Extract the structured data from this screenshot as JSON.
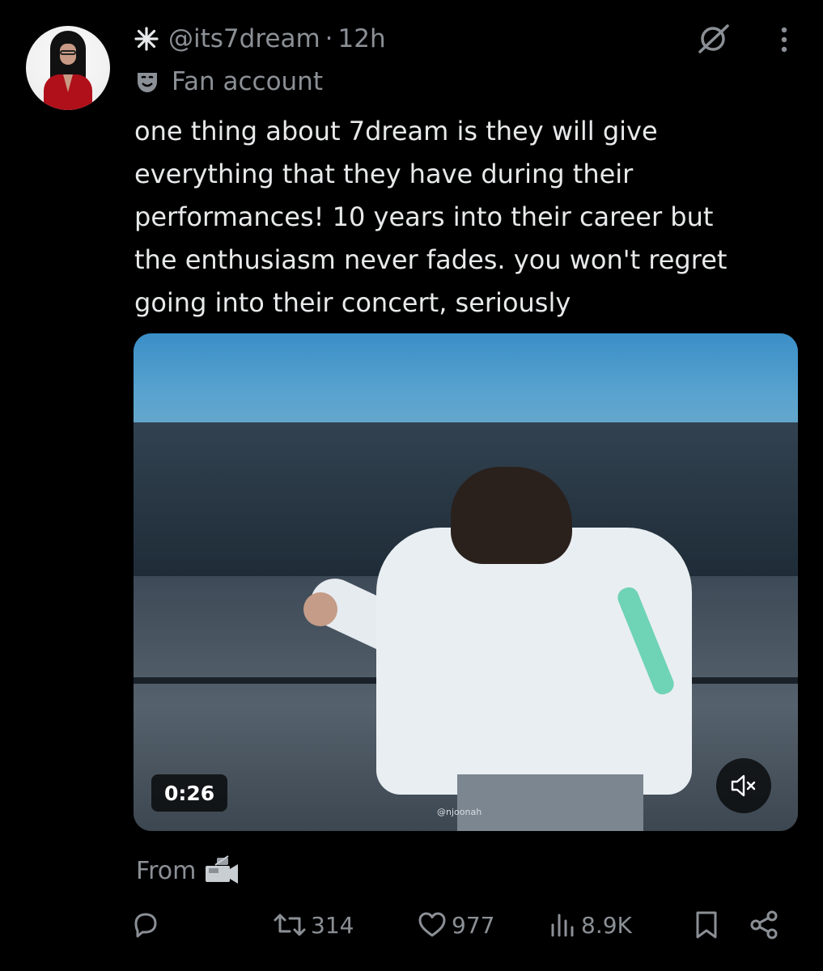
{
  "post": {
    "handle": "@its7dream",
    "separator": "·",
    "time": "12h",
    "account_label": "Fan account",
    "text": "one thing about 7dream is they will give\neverything that they have during their\nperformances! 10 years into their career but\nthe enthusiasm never fades. you won't regret\ngoing into their concert, seriously",
    "media": {
      "duration": "0:26",
      "watermark": "@njoonah",
      "muted": true
    },
    "source_label": "From"
  },
  "actions": {
    "reposts": "314",
    "likes": "977",
    "views": "8.9K"
  },
  "colors": {
    "background": "#000000",
    "text": "#e7e9ea",
    "muted": "#8b9096"
  },
  "icons": [
    "star-icon",
    "grok-icon",
    "more-icon",
    "mask-icon",
    "mute-icon",
    "camera-icon",
    "reply-icon",
    "repost-icon",
    "heart-icon",
    "views-icon",
    "bookmark-icon",
    "share-icon"
  ]
}
